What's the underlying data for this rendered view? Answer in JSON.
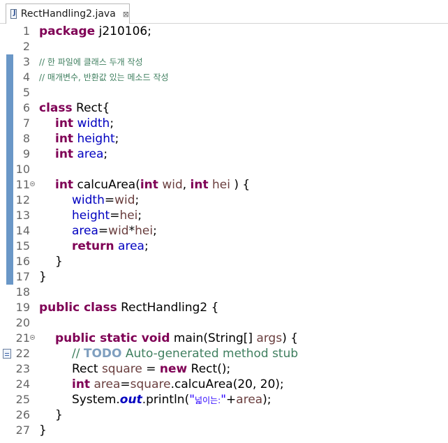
{
  "tab": {
    "title": "RectHandling2.java",
    "close_glyph": "⊠"
  },
  "lines": [
    {
      "num": "1"
    },
    {
      "num": "2"
    },
    {
      "num": "3"
    },
    {
      "num": "4"
    },
    {
      "num": "5"
    },
    {
      "num": "6"
    },
    {
      "num": "7"
    },
    {
      "num": "8"
    },
    {
      "num": "9"
    },
    {
      "num": "10"
    },
    {
      "num": "11"
    },
    {
      "num": "12"
    },
    {
      "num": "13"
    },
    {
      "num": "14"
    },
    {
      "num": "15"
    },
    {
      "num": "16"
    },
    {
      "num": "17"
    },
    {
      "num": "18"
    },
    {
      "num": "19"
    },
    {
      "num": "20"
    },
    {
      "num": "21"
    },
    {
      "num": "22"
    },
    {
      "num": "23"
    },
    {
      "num": "24"
    },
    {
      "num": "25"
    },
    {
      "num": "26"
    },
    {
      "num": "27"
    }
  ],
  "code": {
    "l1": {
      "kw": "package",
      "rest": " j210106;"
    },
    "l3": {
      "text": "// 한 파일에 클래스 두개 작성"
    },
    "l4": {
      "text": "// 매개변수, 반환값 있는 메소드 작성"
    },
    "l6": {
      "kw": "class",
      "rest": " Rect{"
    },
    "l7": {
      "kw": "int",
      "field": "width",
      "rest": ";"
    },
    "l8": {
      "kw": "int",
      "field": "height",
      "rest": ";"
    },
    "l9": {
      "kw": "int",
      "field": "area",
      "rest": ";"
    },
    "l11": {
      "kw1": "int",
      "name": " calcuArea(",
      "kw2": "int",
      "p1": "wid",
      "sep": ", ",
      "kw3": "int",
      "p2": "hei",
      "end": " ) {"
    },
    "l12": {
      "field": "width",
      "eq": "=",
      "param": "wid",
      "end": ";"
    },
    "l13": {
      "field": "height",
      "eq": "=",
      "param": "hei",
      "end": ";"
    },
    "l14": {
      "field": "area",
      "eq": "=",
      "p1": "wid",
      "op": "*",
      "p2": "hei",
      "end": ";"
    },
    "l15": {
      "kw": "return",
      "sp": " ",
      "field": "area",
      "end": ";"
    },
    "l16": {
      "text": "}"
    },
    "l17": {
      "text": "}"
    },
    "l19": {
      "kw": "public class",
      "rest": " RectHandling2 {"
    },
    "l21": {
      "kw": "public static void",
      "name": " main(String[] ",
      "param": "args",
      "end": ") {"
    },
    "l22": {
      "slashes": "// ",
      "todo": "TODO",
      "rest": " Auto-generated method stub"
    },
    "l23": {
      "type": "Rect ",
      "var": "square",
      "eq": " = ",
      "kw": "new",
      "end": " Rect();"
    },
    "l24": {
      "kw": "int",
      "sp": " ",
      "var1": "area",
      "eq": "=",
      "var2": "square",
      "end": ".calcuArea(20, 20);"
    },
    "l25": {
      "pre": "System.",
      "static": "out",
      "mid": ".println(",
      "q1": "\"",
      "kor": "넓이는:",
      "q2": "\"",
      "plus": "+",
      "var": "area",
      "end": ");"
    },
    "l26": {
      "text": "}"
    },
    "l27": {
      "text": "}"
    }
  },
  "colors": {
    "keyword": "#7f0055",
    "field": "#0000c0",
    "parameter": "#6a3e3e",
    "comment": "#3f7f5f",
    "todo": "#7f9fbf",
    "string": "#2a00ff",
    "ruler_marker": "#6a97c7"
  },
  "icons": {
    "tab": "java-file-icon",
    "fold": "collapse-fold-icon",
    "task": "task-marker-icon"
  }
}
